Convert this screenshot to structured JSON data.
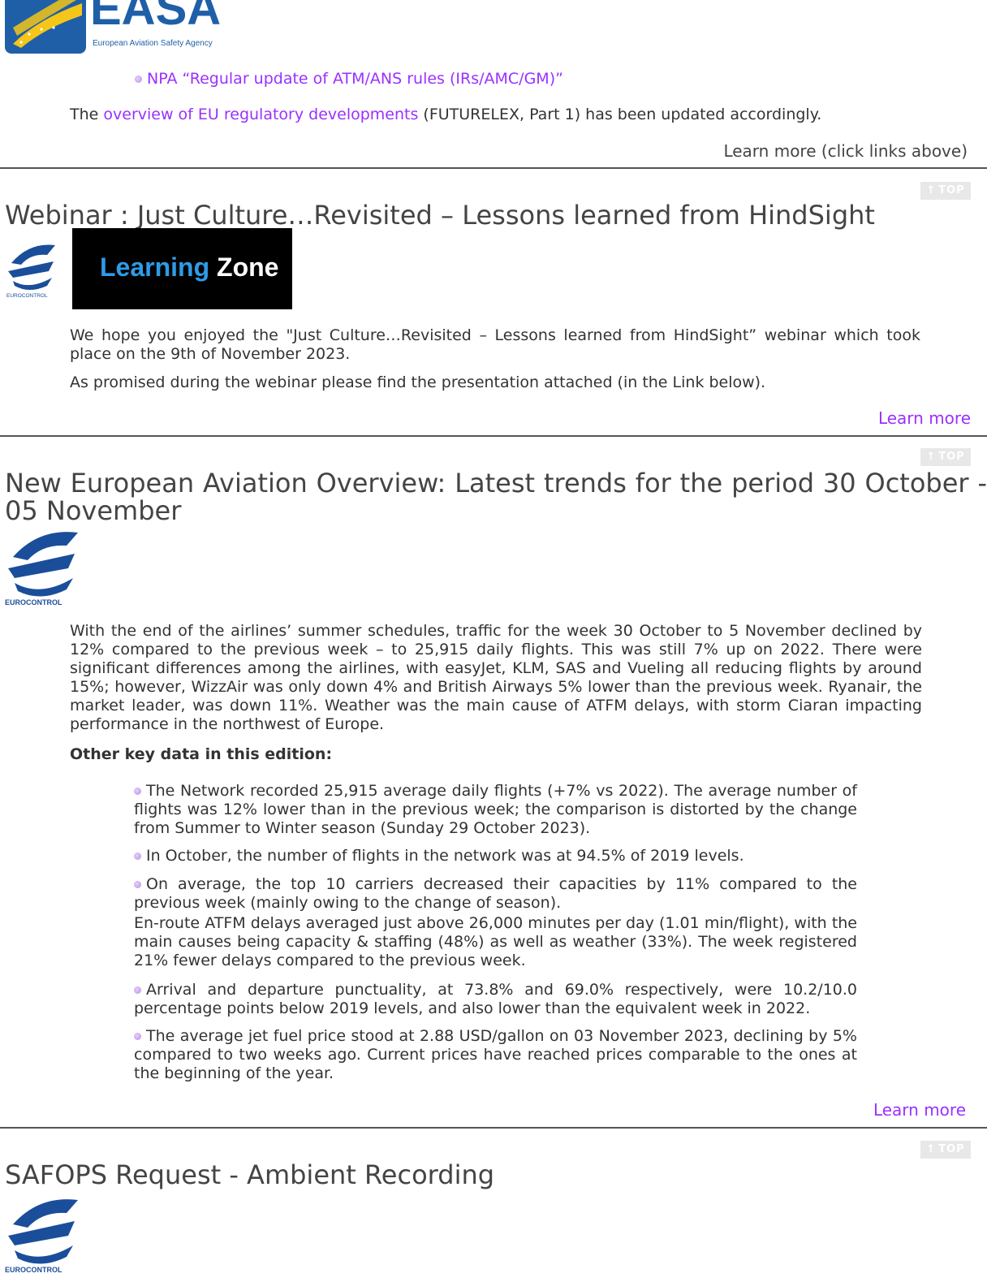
{
  "easa": {
    "logo_text": "EASA",
    "logo_sub": "European Aviation Safety Agency",
    "bullet_link": "NPA “Regular update of ATM/ANS rules (IRs/AMC/GM)”",
    "para_pre": "The ",
    "para_link": "overview of EU regulatory developments",
    "para_post": " (FUTURELEX, Part 1) has been updated accordingly.",
    "learn_more_link": "Learn more",
    "learn_more_suffix": " (click links above)"
  },
  "top_label": "TOP",
  "webinar": {
    "title": "Webinar : Just Culture…Revisited – Lessons learned from HindSight",
    "euro_label": "EUROCONTROL",
    "banner_part1": "Learning",
    "banner_part2": "Zone",
    "para1": "We hope you enjoyed the \"Just Culture…Revisited – Lessons learned from HindSight” webinar which took place on the 9th of November 2023.",
    "para2": "As promised during the webinar please find the presentation attached (in the Link below).",
    "learn_more": "Learn more"
  },
  "overview": {
    "title": "New European Aviation Overview: Latest trends for the period 30 October - 05 November",
    "euro_label": "EUROCONTROL",
    "intro": "With the end of the airlines’ summer schedules, traffic for the week 30 October to 5 November declined by 12% compared to the previous week – to 25,915 daily flights. This was still 7% up on 2022. There were significant differences among the airlines, with easyJet, KLM, SAS and Vueling all reducing flights by around 15%; however, WizzAir was only down 4% and British Airways 5% lower than the previous week. Ryanair, the market leader, was down 11%. Weather was the main cause of ATFM delays, with storm Ciaran impacting performance in the northwest of Europe.",
    "key_heading": "Other key data in this edition:",
    "bullets": [
      "The Network recorded 25,915 average daily flights (+7% vs 2022). The average number of flights was 12% lower than in the previous week; the comparison is distorted by the change from Summer to Winter season (Sunday 29 October 2023).",
      "In October, the number of flights in the network was at 94.5% of 2019 levels.",
      "On average, the top 10 carriers decreased their capacities by 11% compared to the previous week (mainly owing to the change of season).",
      "Arrival and departure punctuality, at 73.8% and 69.0% respectively, were 10.2/10.0 percentage points below 2019 levels, and also lower than the equivalent week in 2022.",
      "The average jet fuel price stood at 2.88 USD/gallon on 03 November 2023, declining by 5% compared to two weeks ago. Current prices have reached prices comparable to the ones at the beginning of the year."
    ],
    "enroute": "En-route ATFM delays averaged just above 26,000 minutes per day (1.01 min/flight), with the main causes being capacity & staffing (48%) as well as weather (33%). The week registered 21% fewer delays compared to the previous week.",
    "learn_more": "Learn more"
  },
  "safops": {
    "title": "SAFOPS Request - Ambient Recording",
    "euro_label": "EUROCONTROL"
  }
}
